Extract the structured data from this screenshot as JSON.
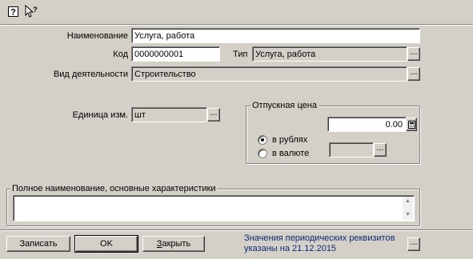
{
  "toolbar": {
    "items": [
      {
        "name": "help-icon",
        "glyph": "?"
      },
      {
        "name": "whats-this-icon",
        "glyph": "↖?"
      }
    ]
  },
  "form": {
    "name_label": "Наименование",
    "name_value": "Услуга, работа",
    "code_label": "Код",
    "code_value": "0000000001",
    "type_label": "Тип",
    "type_value": "Услуга, работа",
    "activity_label": "Вид деятельности",
    "activity_value": "Строительство",
    "unit_label": "Единица изм.",
    "unit_value": "шт",
    "ellipsis": "..."
  },
  "price_group": {
    "title": "Отпускная цена",
    "price_value": "0.00",
    "radio_rubles": "в рублях",
    "radio_currency": "в валюте",
    "selected": "в рублях",
    "currency_value": ""
  },
  "full_name_group": {
    "title": "Полное наименование, основные характеристики",
    "value": ""
  },
  "buttons": {
    "save": "Записать",
    "ok": "OK",
    "close": "Закрыть",
    "close_underline": "З"
  },
  "footer": {
    "line1": "Значения периодических реквизитов",
    "line2": "указаны на 21.12.2015"
  },
  "colors": {
    "window_bg": "#d4d0c8",
    "footer_text": "#0b2a7a"
  }
}
